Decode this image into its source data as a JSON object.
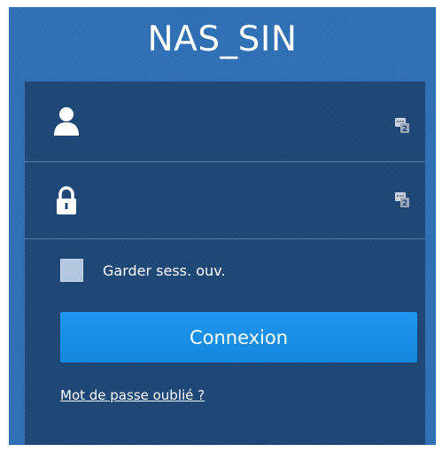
{
  "header": {
    "title": "NAS_SIN"
  },
  "login_form": {
    "username": {
      "value": "",
      "placeholder": "",
      "icon": "user-icon",
      "otp_icon": "otp-code-icon"
    },
    "password": {
      "value": "",
      "placeholder": "",
      "icon": "lock-icon",
      "otp_icon": "otp-code-icon"
    },
    "remember_label": "Garder sess. ouv.",
    "remember_checked": false,
    "login_button_label": "Connexion",
    "forgot_link_label": "Mot de passe oublié ?"
  },
  "colors": {
    "page_background": "#2e6fb5",
    "panel_background": "#1e4675",
    "button": "#1a8fe8",
    "text": "#ffffff",
    "checkbox": "#b3c7de"
  }
}
